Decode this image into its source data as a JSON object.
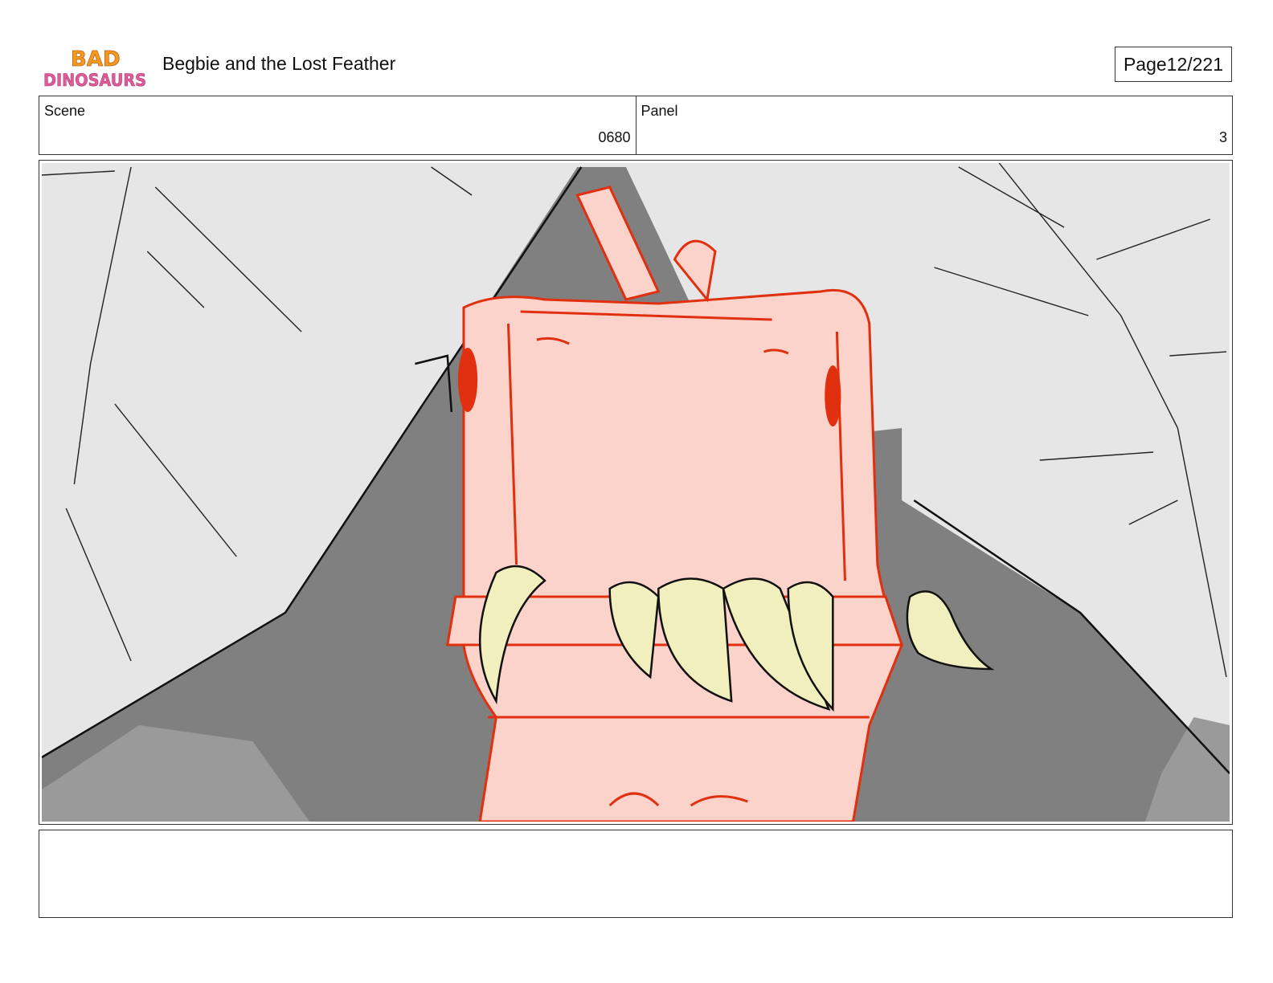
{
  "header": {
    "logo_text_top": "BAD",
    "logo_text_bottom": "DINOSAURS",
    "title": "Begbie and the Lost Feather",
    "page_label": "Page",
    "page_value": "12/221"
  },
  "info": {
    "scene_label": "Scene",
    "scene_value": "0680",
    "panel_label": "Panel",
    "panel_value": "3"
  },
  "notes": {
    "text": ""
  },
  "colors": {
    "sky": "#e6e6e6",
    "shadow": "#808080",
    "dino_skin": "#fbd3ca",
    "dino_line": "#e03010",
    "teeth": "#f2efbe",
    "logo_orange": "#f39a1e"
  }
}
